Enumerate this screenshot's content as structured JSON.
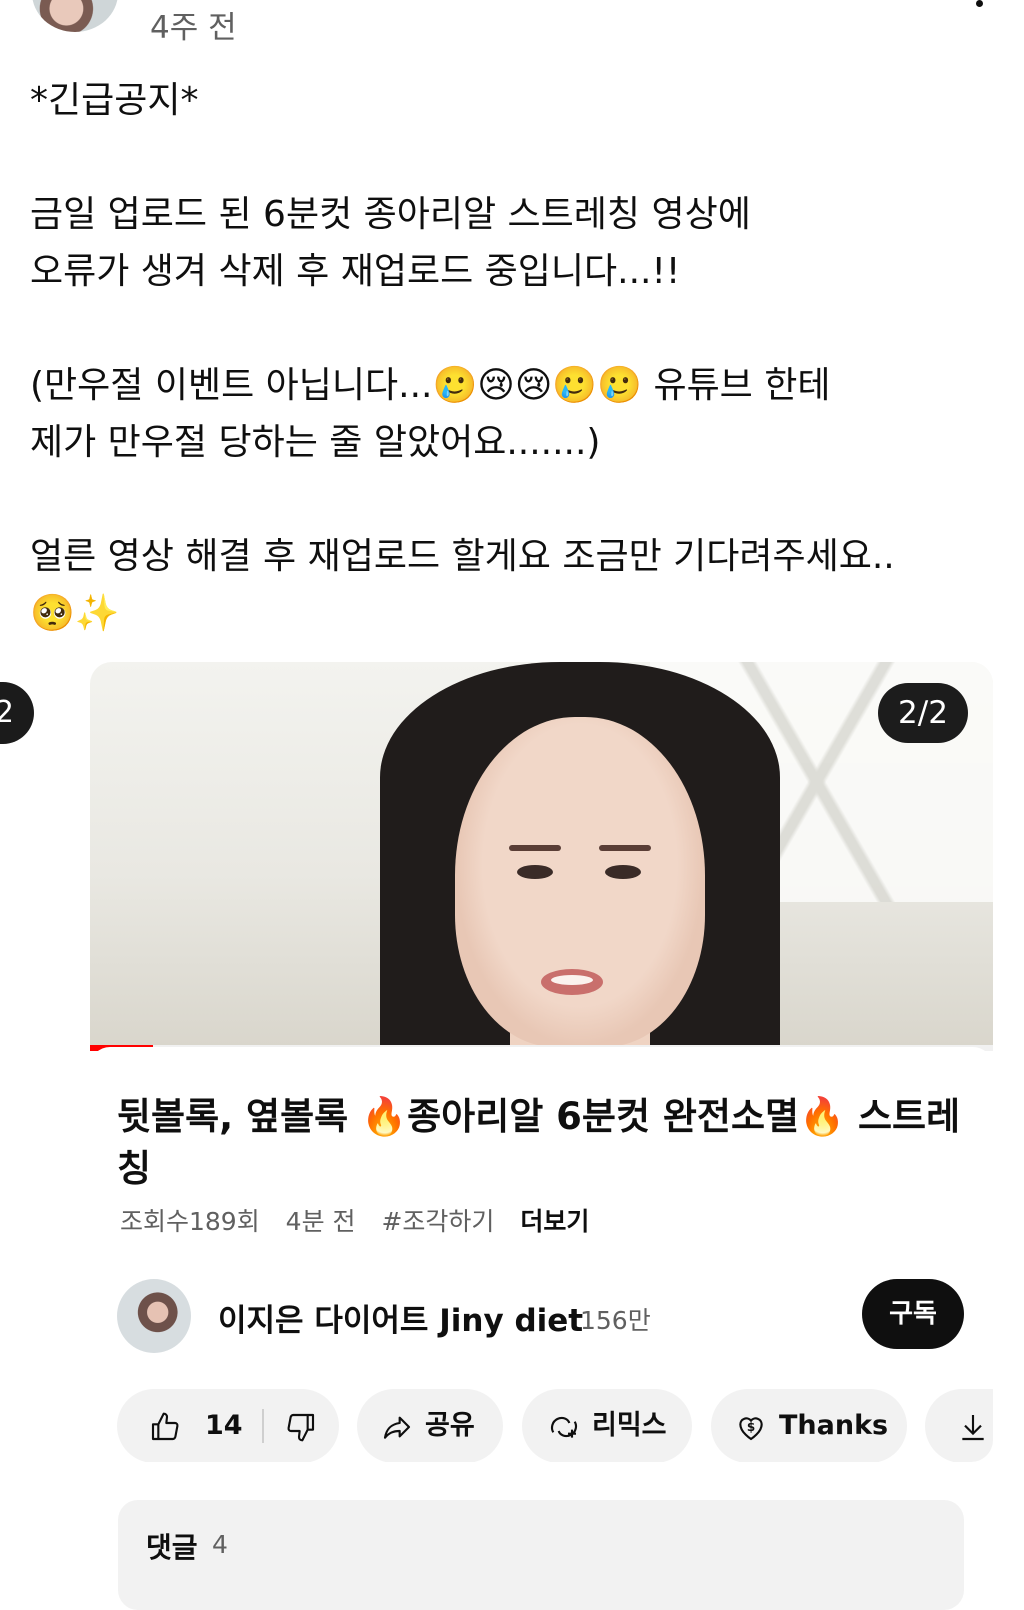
{
  "header": {
    "time_ago": "4주 전"
  },
  "post": {
    "line1": "*긴급공지*",
    "line2": "금일 업로드 된 6분컷 종아리알 스트레칭 영상에",
    "line3": "오류가 생겨 삭제 후 재업로드 중입니다...!!",
    "line4_a": "(만우절 이벤트 아닙니다...",
    "line4_emoji": "🥲😢😢🥲🥲",
    "line4_b": " 유튜브 한테",
    "line5": "제가 만우절 당하는 줄 알았어요.......)",
    "line6": "얼른 영상 해결 후 재업로드 할게요 조금만 기다려주세요..",
    "line7": "🥺✨"
  },
  "carousel": {
    "prev_count": "2",
    "page": "2/2"
  },
  "video": {
    "progress_fraction": 0.07,
    "title": "뒷볼록, 옆볼록 🔥종아리알 6분컷 완전소멸🔥 스트레칭",
    "views": "조회수189회",
    "uploaded": "4분 전",
    "hashtag": "#조각하기",
    "more": "더보기"
  },
  "channel": {
    "name": "이지은 다이어트 Jiny diet",
    "subscribers": "156만",
    "subscribe_label": "구독"
  },
  "actions": {
    "likes": "14",
    "share": "공유",
    "remix": "리믹스",
    "thanks": "Thanks"
  },
  "comments": {
    "label": "댓글",
    "count": "4"
  },
  "colors": {
    "accent_red": "#ff0000",
    "text_primary": "#0f0f0f",
    "text_secondary": "#606060",
    "pill_bg": "#f2f2f2"
  }
}
